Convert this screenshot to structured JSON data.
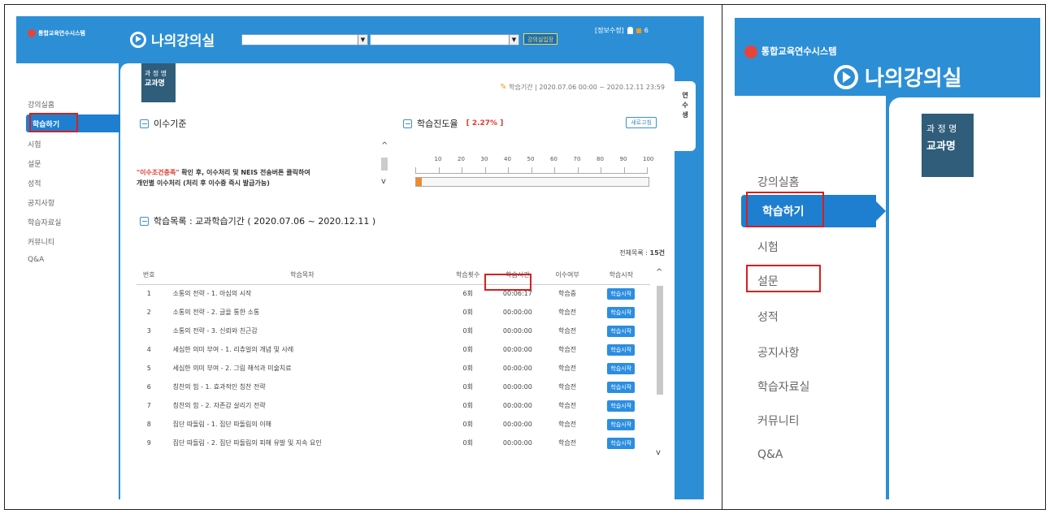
{
  "header": {
    "logo_line1": "",
    "logo_line2": "통합교육연수시스템",
    "brand": "나의강의실",
    "enter_button": "강의실입장",
    "info_edit": "[정보수정]",
    "notification_count": "6"
  },
  "sidebar": {
    "items": [
      {
        "label": "강의실홈"
      },
      {
        "label": "학습하기"
      },
      {
        "label": "시험"
      },
      {
        "label": "설문"
      },
      {
        "label": "성적"
      },
      {
        "label": "공지사항"
      },
      {
        "label": "학습자료실"
      },
      {
        "label": "커뮤니티"
      },
      {
        "label": "Q&A"
      }
    ],
    "active_index": 1
  },
  "course": {
    "tag_label": "과 정 명",
    "tag_name": "교과명",
    "period": "학습기간 | 2020.07.06 00:00 ~ 2020.12.11 23:59"
  },
  "criteria": {
    "title": "이수기준",
    "text_red": "\"이수조건충족\"",
    "text_line1": " 확인 후, 이수처리 및 NEIS 전송버튼 클릭하여",
    "text_line2": "개인별 이수처리 (처리 후 이수증 즉시 발급가능)"
  },
  "progress": {
    "title": "학습진도율",
    "percent_text": "[ 2.27% ]",
    "percent": 2.27,
    "refresh_button": "새로고침",
    "scale": [
      "10",
      "20",
      "30",
      "40",
      "50",
      "60",
      "70",
      "80",
      "90",
      "100"
    ]
  },
  "lesson_list": {
    "title": "학습목록 : 교과학습기간 ( 2020.07.06 ~ 2020.12.11 )",
    "total": "전체목록 : ",
    "total_count": "15건",
    "columns": [
      "번호",
      "학습목차",
      "학습횟수",
      "학습시간",
      "이수여부",
      "학습시작"
    ],
    "rows": [
      {
        "no": "1",
        "title": "소통의 전략 - 1. 아심의 시작",
        "count": "6회",
        "time": "00:06:17",
        "status": "학습중",
        "button": "학습시작"
      },
      {
        "no": "2",
        "title": "소통의 전략 - 2. 글을 통한 소통",
        "count": "0회",
        "time": "00:00:00",
        "status": "학습전",
        "button": "학습시작"
      },
      {
        "no": "3",
        "title": "소통의 전략 - 3. 신뢰와 친근감",
        "count": "0회",
        "time": "00:00:00",
        "status": "학습전",
        "button": "학습시작"
      },
      {
        "no": "4",
        "title": "세심한 의미 부여 - 1. 리츄얼의 개념 및 사례",
        "count": "0회",
        "time": "00:00:00",
        "status": "학습전",
        "button": "학습시작"
      },
      {
        "no": "5",
        "title": "세심한 의미 부여 - 2. 그림 해석과 미술치료",
        "count": "0회",
        "time": "00:00:00",
        "status": "학습전",
        "button": "학습시작"
      },
      {
        "no": "6",
        "title": "칭찬의 힘 - 1. 효과적인 칭찬 전략",
        "count": "0회",
        "time": "00:00:00",
        "status": "학습전",
        "button": "학습시작"
      },
      {
        "no": "7",
        "title": "칭찬의 힘 - 2. 자존감 살리기 전략",
        "count": "0회",
        "time": "00:00:00",
        "status": "학습전",
        "button": "학습시작"
      },
      {
        "no": "8",
        "title": "집단 따돌림 - 1. 집단 따돌림의 이해",
        "count": "0회",
        "time": "00:00:00",
        "status": "학습전",
        "button": "학습시작"
      },
      {
        "no": "9",
        "title": "집단 따돌림 - 2. 집단 따돌림의 피해 유발 및 지속 요인",
        "count": "0회",
        "time": "00:00:00",
        "status": "학습전",
        "button": "학습시작"
      }
    ]
  },
  "side_tab": {
    "label": "연수생"
  },
  "zoom": {
    "brand": "나의강의실",
    "tag_label": "과 정 명",
    "tag_name": "교과명"
  },
  "colors": {
    "accent": "#2c8fd6",
    "highlight": "#d91e1e",
    "done": "#3aa535",
    "todo": "#e03b2f"
  }
}
